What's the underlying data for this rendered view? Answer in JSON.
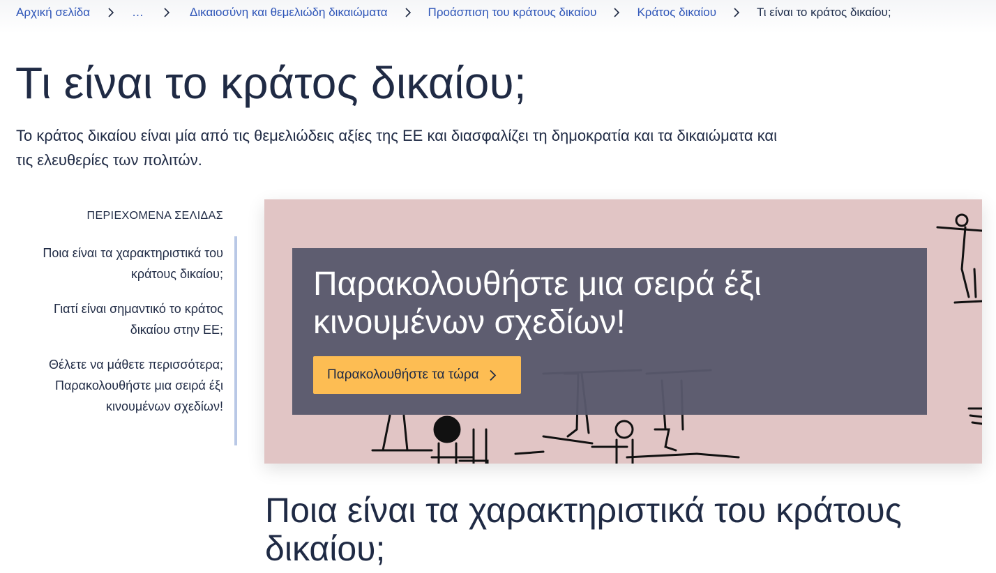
{
  "breadcrumb": {
    "items": [
      "Αρχική σελίδα",
      "…",
      "Δικαιοσύνη και θεμελιώδη δικαιώματα",
      "Προάσπιση του κράτους δικαίου",
      "Κράτος δικαίου"
    ],
    "current": "Τι είναι το κράτος δικαίου;"
  },
  "page": {
    "title": "Τι είναι το κράτος δικαίου;",
    "lead": "Το κράτος δικαίου είναι μία από τις θεμελιώδεις αξίες της ΕΕ και διασφαλίζει τη δημοκρατία και τα δικαιώματα και τις ελευθερίες των πολιτών."
  },
  "toc": {
    "title": "ΠΕΡΙΕΧΟΜΕΝΑ ΣΕΛΙΔΑΣ",
    "items": [
      "Ποια είναι τα χαρακτηριστικά του κράτους δικαίου;",
      "Γιατί είναι σημαντικό το κράτος δικαίου στην ΕΕ;",
      "Θέλετε να μάθετε περισσότερα; Παρακολουθήστε μια σειρά έξι κινουμένων σχεδίων!"
    ]
  },
  "banner": {
    "title": "Παρακολουθήστε μια σειρά έξι κινουμένων σχεδίων!",
    "cta_label": "Παρακολουθήστε τα τώρα",
    "background_color": "#e1c5c5",
    "overlay_color": "#5a5a6c",
    "cta_color": "#fdbd53"
  },
  "section": {
    "heading": "Ποια είναι τα χαρακτηριστικά του κράτους δικαίου;"
  },
  "colors": {
    "link": "#2e55b8",
    "text": "#1f2a44",
    "toc_border": "#b9c8e6"
  }
}
